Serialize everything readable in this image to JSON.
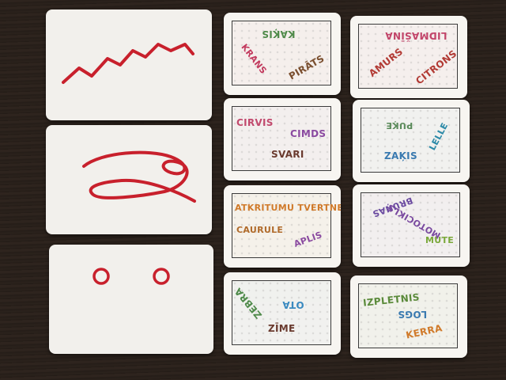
{
  "photo": {
    "description_free": true,
    "line_color": "#c8202c",
    "shape_cards": [
      {
        "shape": "zigzag-line-icon"
      },
      {
        "shape": "loop-squiggle-icon"
      },
      {
        "shape": "two-circles-icon"
      }
    ],
    "word_cards": [
      {
        "words": [
          {
            "text": "KAĶIS",
            "color": "#4f8a4a"
          },
          {
            "text": "KRANS",
            "color": "#c23a5e"
          },
          {
            "text": "PIRĀTS",
            "color": "#7a4e2e"
          }
        ]
      },
      {
        "words": [
          {
            "text": "LIDMAŠĪNA",
            "color": "#c2456a"
          },
          {
            "text": "AMURS",
            "color": "#b23a34"
          },
          {
            "text": "CITRONS",
            "color": "#b23a34"
          }
        ]
      },
      {
        "words": [
          {
            "text": "CIRVIS",
            "color": "#c24a6e"
          },
          {
            "text": "CIMDS",
            "color": "#8a4aa0"
          },
          {
            "text": "SVARI",
            "color": "#6a3a2e"
          }
        ]
      },
      {
        "words": [
          {
            "text": "PUĶE",
            "color": "#5a8a5a"
          },
          {
            "text": "ZAĶIS",
            "color": "#3a7ab0"
          },
          {
            "text": "LELLE",
            "color": "#2c8aa8"
          }
        ]
      },
      {
        "words": [
          {
            "text": "ATKRITUMU TVERTNE",
            "color": "#d07a2a"
          },
          {
            "text": "CAURULE",
            "color": "#b06a2a"
          },
          {
            "text": "APLIS",
            "color": "#8a4aa0"
          }
        ]
      },
      {
        "words": [
          {
            "text": "BRUŅAS",
            "color": "#6a4aa0"
          },
          {
            "text": "MOTOCIKLS",
            "color": "#7a4aa0"
          },
          {
            "text": "MUTE",
            "color": "#7aa83a"
          }
        ]
      },
      {
        "words": [
          {
            "text": "ZEBRA",
            "color": "#4f8a4a"
          },
          {
            "text": "OTA",
            "color": "#3a8ac0"
          },
          {
            "text": "ZĪME",
            "color": "#6a3a2e"
          }
        ]
      },
      {
        "words": [
          {
            "text": "IZPLETNIS",
            "color": "#5a8a3a"
          },
          {
            "text": "LOGS",
            "color": "#3a7ab0"
          },
          {
            "text": "KERRA",
            "color": "#d07a2a"
          }
        ]
      }
    ]
  }
}
